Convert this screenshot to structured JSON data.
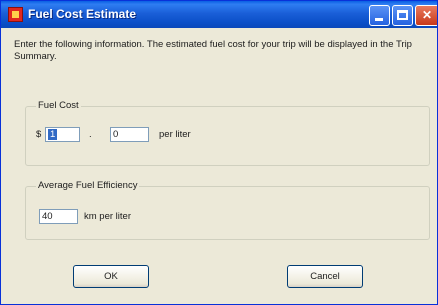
{
  "window": {
    "title": "Fuel Cost Estimate"
  },
  "intro": {
    "text": "Enter the following information. The estimated fuel cost for your trip will be displayed in the Trip Summary."
  },
  "fuel_cost": {
    "legend": "Fuel Cost",
    "currency_symbol": "$",
    "dollars_value": "1",
    "separator": ".",
    "cents_value": "0",
    "unit": "per liter"
  },
  "efficiency": {
    "legend": "Average Fuel Efficiency",
    "value": "40",
    "unit": "km per liter"
  },
  "buttons": {
    "ok": "OK",
    "cancel": "Cancel"
  },
  "icons": {
    "app": "app-icon",
    "minimize": "minimize-icon",
    "maximize": "maximize-icon",
    "close": "close-icon"
  },
  "colors": {
    "titlebar": "#0a5fe3",
    "dialog_bg": "#ece9d8",
    "selection": "#316ac5"
  }
}
